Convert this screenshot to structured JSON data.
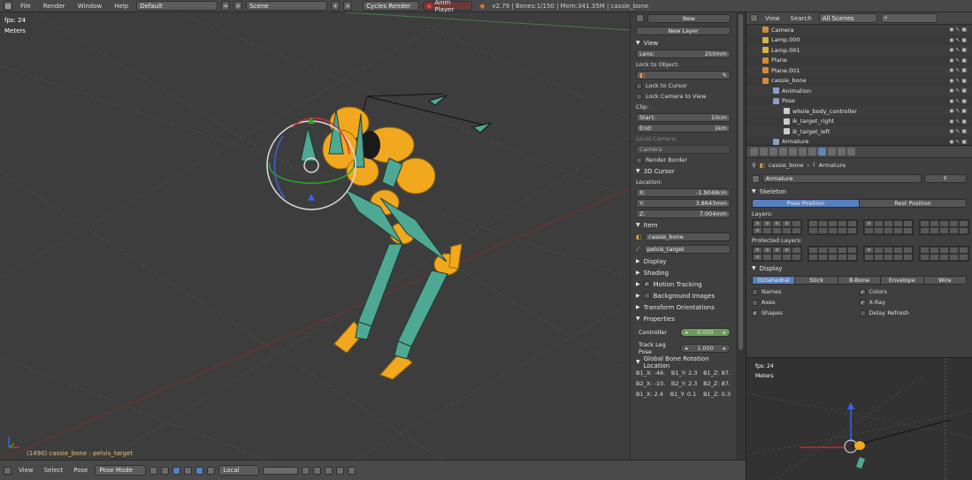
{
  "topbar": {
    "menus": [
      "File",
      "Render",
      "Window",
      "Help"
    ],
    "layout": "Default",
    "scene": "Scene",
    "engine": "Cycles Render",
    "anim_player": "Anim Player",
    "stats": "v2.79 | Bones:1/150 | Mem:341.35M | cassie_bone"
  },
  "viewport": {
    "fps": "fps: 24",
    "units": "Meters",
    "status": "(1490) cassie_bone : pelvis_target"
  },
  "bottombar": {
    "items": [
      "View",
      "Select",
      "Pose"
    ],
    "mode": "Pose Mode",
    "pivot": "Local"
  },
  "npanel": {
    "new": "New",
    "new_layer": "New Layer",
    "view": {
      "title": "View",
      "lens_label": "Lens:",
      "lens_value": "250mm",
      "lock_to_object": "Lock to Object:",
      "lock_to_cursor": "Lock to Cursor",
      "lock_camera": "Lock Camera to View",
      "clip": "Clip:",
      "start_label": "Start:",
      "start_value": "10cm",
      "end_label": "End:",
      "end_value": "1km",
      "local_camera": "Local Camera:",
      "camera": "Camera",
      "render_border": "Render Border"
    },
    "cursor": {
      "title": "3D Cursor",
      "location": "Location:",
      "x_label": "X:",
      "x_value": "-1.9048cm",
      "y_label": "Y:",
      "y_value": "3.8643mm",
      "z_label": "Z:",
      "z_value": "7.004mm"
    },
    "item": {
      "title": "Item",
      "object": "cassie_bone",
      "bone": "pelvis_target"
    },
    "collapsed": [
      "Display",
      "Shading",
      "Motion Tracking",
      "Background Images",
      "Transform Orientations"
    ],
    "properties": {
      "title": "Properties",
      "controller_label": "Controller",
      "controller_value": "0.000",
      "trackleg_label": "Track Leg Pose",
      "trackleg_value": "1.000"
    },
    "gbr": {
      "title": "Global Bone Rotation Location",
      "rows": [
        [
          "B1_X: -46.",
          "B1_Y: 2.3",
          "B1_Z: 87."
        ],
        [
          "B2_X: -10.",
          "B2_Y: 2.3",
          "B2_Z: 87."
        ],
        [
          "B1_X: 2.4",
          "B1_Y: 0.1",
          "B1_Z: 0.3"
        ]
      ]
    }
  },
  "outliner": {
    "view": "View",
    "search": "Search",
    "scenes": "All Scenes",
    "rows": [
      {
        "name": "Camera",
        "color": "#d08c3a",
        "indent": 18
      },
      {
        "name": "Lamp.000",
        "color": "#d6b24a",
        "indent": 18
      },
      {
        "name": "Lamp.001",
        "color": "#d6b24a",
        "indent": 18
      },
      {
        "name": "Plane",
        "color": "#d08c3a",
        "indent": 18
      },
      {
        "name": "Plane.001",
        "color": "#d08c3a",
        "indent": 18
      },
      {
        "name": "cassie_bone",
        "color": "#d08c3a",
        "indent": 18
      },
      {
        "name": "Animation",
        "color": "#8aa0c0",
        "indent": 30
      },
      {
        "name": "Pose",
        "color": "#8aa0c0",
        "indent": 30
      },
      {
        "name": "whole_body_controller",
        "color": "#cccccc",
        "indent": 42
      },
      {
        "name": "ik_target_right",
        "color": "#cccccc",
        "indent": 42
      },
      {
        "name": "ik_target_left",
        "color": "#cccccc",
        "indent": 42
      },
      {
        "name": "Armature",
        "color": "#8aa0c0",
        "indent": 30
      }
    ]
  },
  "properties": {
    "breadcrumb_obj": "cassie_bone",
    "breadcrumb_data": "Armature",
    "data_name": "Armature",
    "data_users": "F",
    "skeleton": "Skeleton",
    "pose_position": "Pose Position",
    "rest_position": "Rest Position",
    "layers": "Layers:",
    "protected_layers": "Protected Layers:",
    "display": "Display",
    "display_modes": [
      "Octahedral",
      "Stick",
      "B-Bone",
      "Envelope",
      "Wire"
    ],
    "options_left": [
      {
        "label": "Names",
        "checked": false
      },
      {
        "label": "Axes",
        "checked": false
      },
      {
        "label": "Shapes",
        "checked": true
      }
    ],
    "options_right": [
      {
        "label": "Colors",
        "checked": true
      },
      {
        "label": "X-Ray",
        "checked": true
      },
      {
        "label": "Delay Refresh",
        "checked": false
      }
    ]
  },
  "mini": {
    "fps": "fps: 24",
    "units": "Meters"
  },
  "colors": {
    "accent": "#5680c2",
    "armature_orange": "#f2a81e",
    "bone_teal": "#4fa893"
  }
}
